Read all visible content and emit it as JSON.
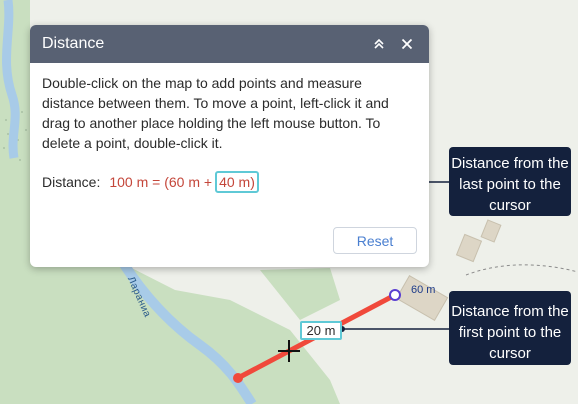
{
  "panel": {
    "title": "Distance",
    "description": "Double-click on the map to add points and measure distance between them. To move a point, left-click it and drag to another place holding the left mouse button. To delete a point, double-click it.",
    "distance_label": "Distance:",
    "distance_total": "100 m = (60 m +",
    "distance_to_cursor": "40 m)",
    "reset_label": "Reset"
  },
  "map": {
    "point_label": "60 m",
    "segment_label": "20 m",
    "road_name": "Лараниа"
  },
  "callouts": {
    "last_point": "Distance from the last point to the cursor",
    "first_point": "Distance from the first point to the cursor"
  },
  "colors": {
    "header": "#586173",
    "measure_line": "#f0493b",
    "highlight": "#5fc9d6",
    "callout_bg": "#14213d",
    "distance_text": "#c4463a"
  }
}
